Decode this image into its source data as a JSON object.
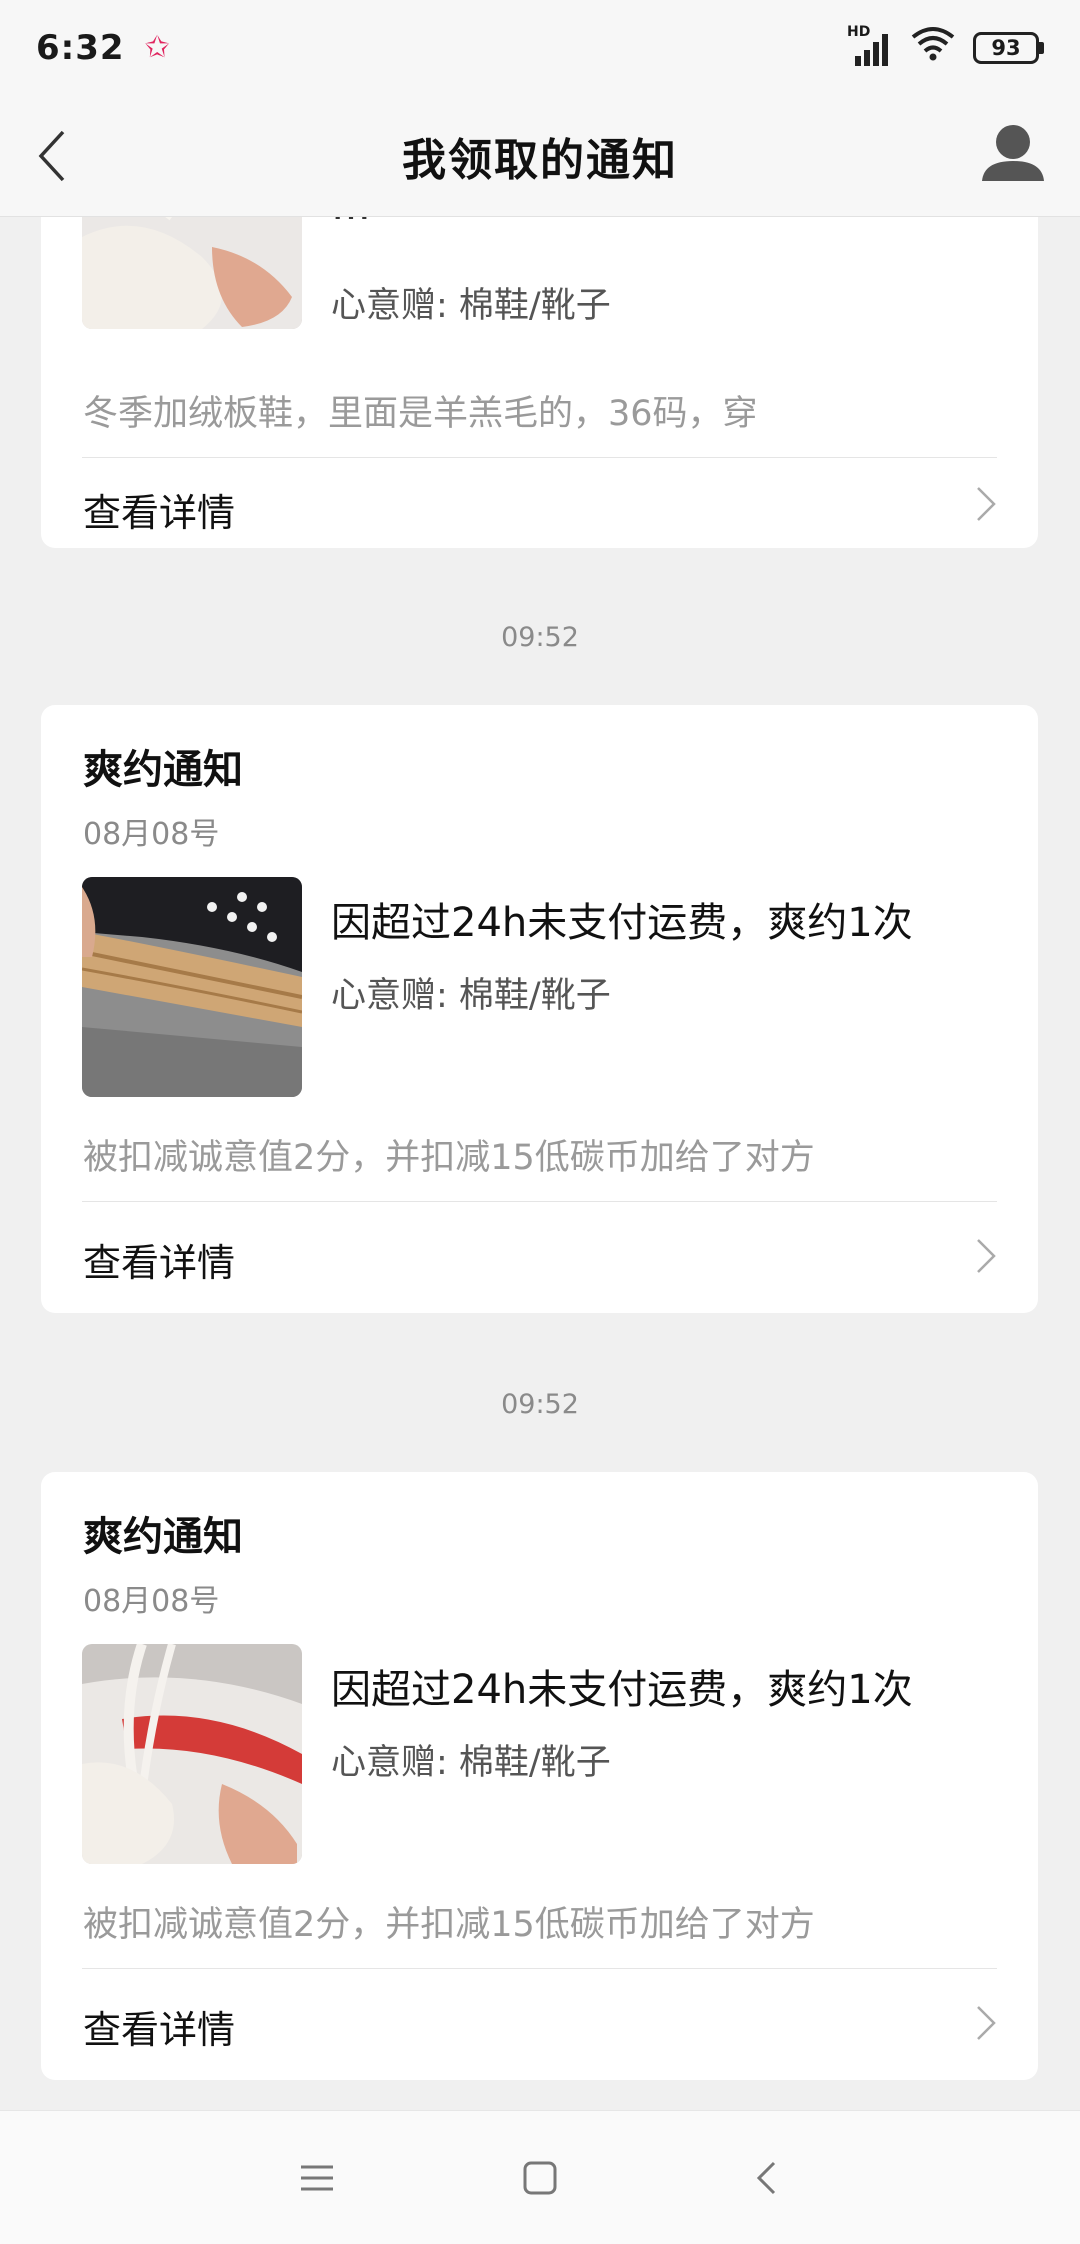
{
  "status": {
    "time": "6:32",
    "battery": "93",
    "network": "HD"
  },
  "nav": {
    "title": "我领取的通知"
  },
  "cards": [
    {
      "headline": "…",
      "gift": "心意赠: 棉鞋/靴子",
      "desc": "冬季加绒板鞋，里面是羊羔毛的，36码，穿",
      "detail": "查看详情"
    },
    {
      "title": "爽约通知",
      "date": "08月08号",
      "headline": "因超过24h未支付运费，爽约1次",
      "gift": "心意赠: 棉鞋/靴子",
      "desc": "被扣减诚意值2分，并扣减15低碳币加给了对方",
      "detail": "查看详情"
    },
    {
      "title": "爽约通知",
      "date": "08月08号",
      "headline": "因超过24h未支付运费，爽约1次",
      "gift": "心意赠: 棉鞋/靴子",
      "desc": "被扣减诚意值2分，并扣减15低碳币加给了对方",
      "detail": "查看详情"
    }
  ],
  "separators": [
    "09:52",
    "09:52"
  ],
  "icons": {
    "back": "chevron-left-icon",
    "user": "user-icon",
    "chevron": "chevron-right-icon",
    "menu": "menu-icon",
    "home": "home-icon",
    "sysback": "back-icon"
  }
}
